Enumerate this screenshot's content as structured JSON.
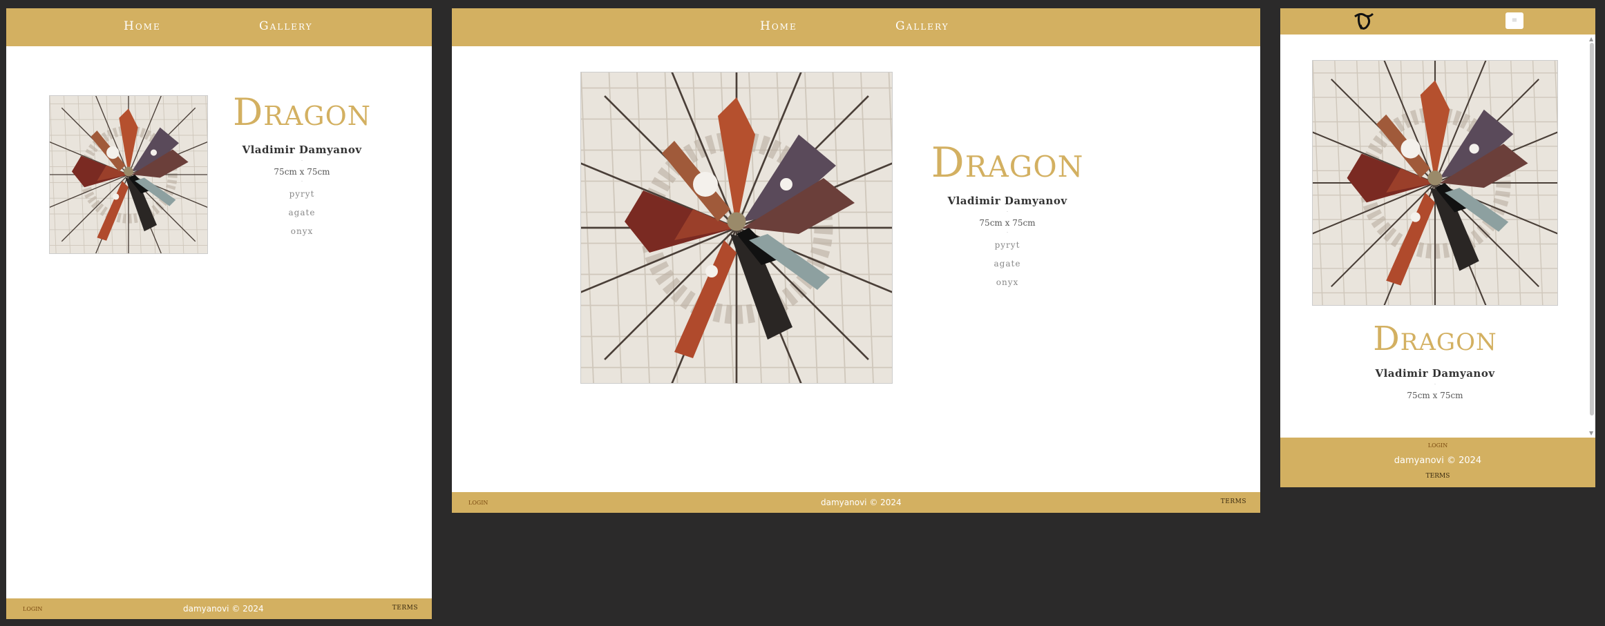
{
  "nav": {
    "home": "Home",
    "gallery": "Gallery"
  },
  "artwork": {
    "title": "Dragon",
    "artist": "Vladimir Damyanov",
    "separator": "-",
    "size": "75cm x 75cm",
    "materials": [
      "pyryt",
      "agate",
      "onyx"
    ]
  },
  "footer": {
    "login": "login",
    "copyright": "damyanovi © 2024",
    "terms": "TERMS"
  },
  "mobile": {
    "menu_icon": "≡",
    "logo_icon": "brand-logo-icon"
  },
  "colors": {
    "accent": "#d3b061",
    "background": "#2b2a2a"
  }
}
